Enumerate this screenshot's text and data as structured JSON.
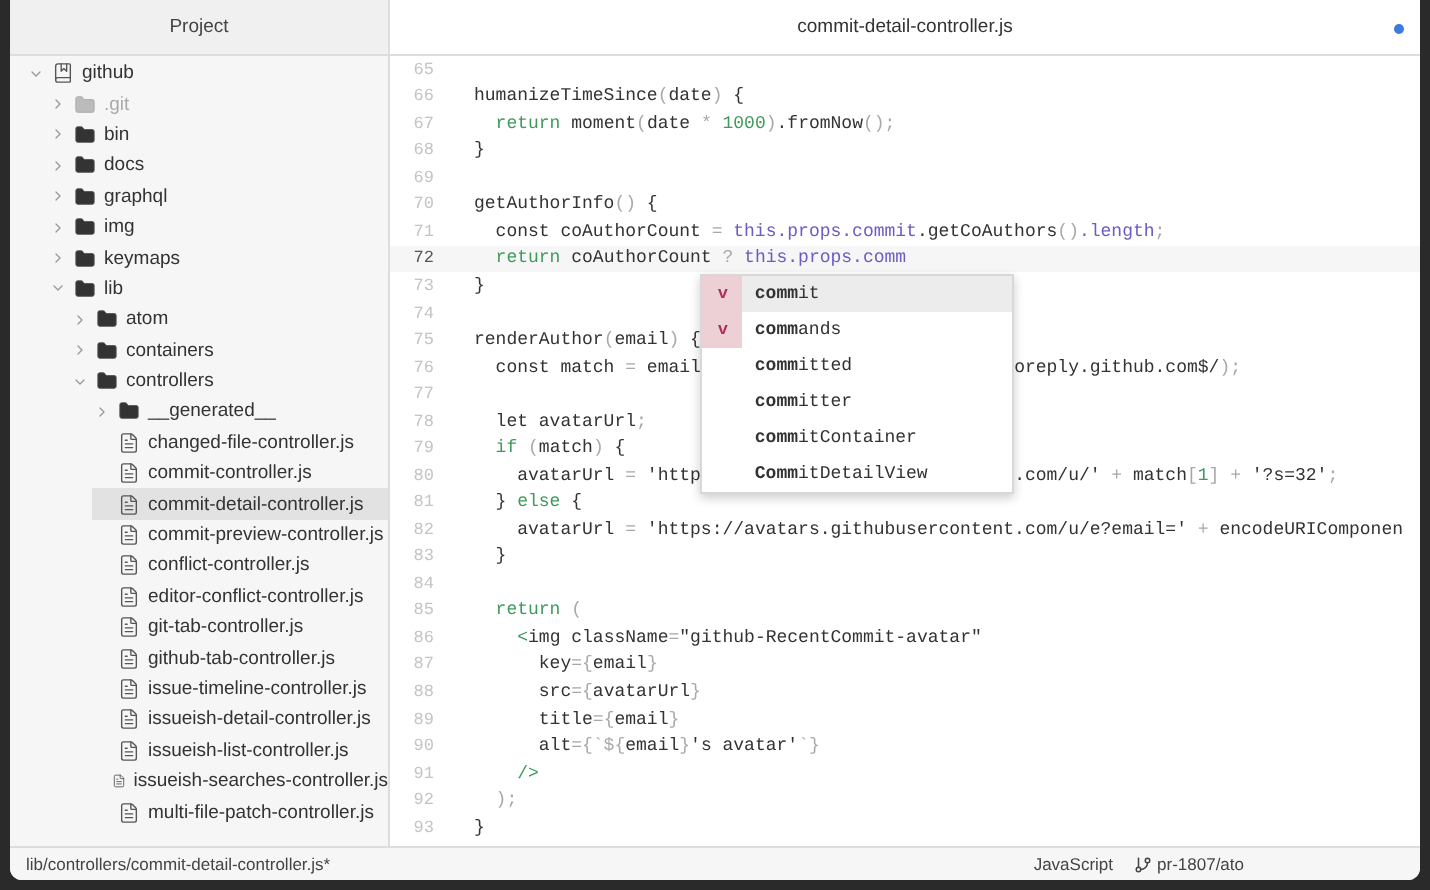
{
  "sidebar": {
    "title": "Project",
    "tree": [
      {
        "name": "github",
        "kind": "repo",
        "expanded": true,
        "selected": false,
        "dim": false,
        "children": [
          {
            "name": ".git",
            "kind": "folder",
            "expanded": false,
            "selected": false,
            "dim": true
          },
          {
            "name": "bin",
            "kind": "folder",
            "expanded": false,
            "selected": false,
            "dim": false
          },
          {
            "name": "docs",
            "kind": "folder",
            "expanded": false,
            "selected": false,
            "dim": false
          },
          {
            "name": "graphql",
            "kind": "folder",
            "expanded": false,
            "selected": false,
            "dim": false
          },
          {
            "name": "img",
            "kind": "folder",
            "expanded": false,
            "selected": false,
            "dim": false
          },
          {
            "name": "keymaps",
            "kind": "folder",
            "expanded": false,
            "selected": false,
            "dim": false
          },
          {
            "name": "lib",
            "kind": "folder",
            "expanded": true,
            "selected": false,
            "dim": false,
            "children": [
              {
                "name": "atom",
                "kind": "folder",
                "expanded": false,
                "selected": false,
                "dim": false
              },
              {
                "name": "containers",
                "kind": "folder",
                "expanded": false,
                "selected": false,
                "dim": false
              },
              {
                "name": "controllers",
                "kind": "folder",
                "expanded": true,
                "selected": false,
                "dim": false,
                "children": [
                  {
                    "name": "__generated__",
                    "kind": "folder",
                    "expanded": false,
                    "selected": false,
                    "dim": false
                  },
                  {
                    "name": "changed-file-controller.js",
                    "kind": "file",
                    "selected": false,
                    "dim": false
                  },
                  {
                    "name": "commit-controller.js",
                    "kind": "file",
                    "selected": false,
                    "dim": false
                  },
                  {
                    "name": "commit-detail-controller.js",
                    "kind": "file",
                    "selected": true,
                    "dim": false
                  },
                  {
                    "name": "commit-preview-controller.js",
                    "kind": "file",
                    "selected": false,
                    "dim": false
                  },
                  {
                    "name": "conflict-controller.js",
                    "kind": "file",
                    "selected": false,
                    "dim": false
                  },
                  {
                    "name": "editor-conflict-controller.js",
                    "kind": "file",
                    "selected": false,
                    "dim": false
                  },
                  {
                    "name": "git-tab-controller.js",
                    "kind": "file",
                    "selected": false,
                    "dim": false
                  },
                  {
                    "name": "github-tab-controller.js",
                    "kind": "file",
                    "selected": false,
                    "dim": false
                  },
                  {
                    "name": "issue-timeline-controller.js",
                    "kind": "file",
                    "selected": false,
                    "dim": false
                  },
                  {
                    "name": "issueish-detail-controller.js",
                    "kind": "file",
                    "selected": false,
                    "dim": false
                  },
                  {
                    "name": "issueish-list-controller.js",
                    "kind": "file",
                    "selected": false,
                    "dim": false
                  },
                  {
                    "name": "issueish-searches-controller.js",
                    "kind": "file",
                    "selected": false,
                    "dim": false
                  },
                  {
                    "name": "multi-file-patch-controller.js",
                    "kind": "file",
                    "selected": false,
                    "dim": false
                  }
                ]
              }
            ]
          }
        ]
      }
    ]
  },
  "editor": {
    "tab": {
      "title": "commit-detail-controller.js",
      "modified": true
    },
    "lines": [
      {
        "number": "65",
        "current": false
      },
      {
        "number": "66",
        "current": false,
        "tokens": [
          {
            "text": "humanizeTimeSince",
            "kind": "plain"
          },
          {
            "text": "(",
            "kind": "punct"
          },
          {
            "text": "date",
            "kind": "plain"
          },
          {
            "text": ")",
            "kind": "punct"
          },
          {
            "text": " {",
            "kind": "plain"
          }
        ]
      },
      {
        "number": "67",
        "current": false,
        "tokens": [
          {
            "text": "  return",
            "kind": "keyword"
          },
          {
            "text": " moment",
            "kind": "plain"
          },
          {
            "text": "(",
            "kind": "punct"
          },
          {
            "text": "date ",
            "kind": "plain"
          },
          {
            "text": "*",
            "kind": "punct"
          },
          {
            "text": " 1000",
            "kind": "keyword"
          },
          {
            "text": ")",
            "kind": "punct"
          },
          {
            "text": ".fromNow",
            "kind": "plain"
          },
          {
            "text": "();",
            "kind": "punct"
          }
        ]
      },
      {
        "number": "68",
        "current": false,
        "tokens": [
          {
            "text": "}",
            "kind": "plain"
          }
        ]
      },
      {
        "number": "69",
        "current": false
      },
      {
        "number": "70",
        "current": false,
        "tokens": [
          {
            "text": "getAuthorInfo",
            "kind": "plain"
          },
          {
            "text": "()",
            "kind": "punct"
          },
          {
            "text": " {",
            "kind": "plain"
          }
        ]
      },
      {
        "number": "71",
        "current": false,
        "tokens": [
          {
            "text": "  const coAuthorCount ",
            "kind": "plain"
          },
          {
            "text": "=",
            "kind": "punct"
          },
          {
            "text": " this.props.commit",
            "kind": "prop"
          },
          {
            "text": ".getCoAuthors",
            "kind": "plain"
          },
          {
            "text": "()",
            "kind": "punct"
          },
          {
            "text": ".length",
            "kind": "prop"
          },
          {
            "text": ";",
            "kind": "punct"
          }
        ]
      },
      {
        "number": "72",
        "current": true,
        "tokens": [
          {
            "text": "  return",
            "kind": "keyword"
          },
          {
            "text": " coAuthorCount ",
            "kind": "plain"
          },
          {
            "text": "?",
            "kind": "punct"
          },
          {
            "text": " this.props.comm",
            "kind": "prop"
          }
        ]
      },
      {
        "number": "73",
        "current": false,
        "tokens": [
          {
            "text": "}",
            "kind": "plain"
          }
        ]
      },
      {
        "number": "74",
        "current": false
      },
      {
        "number": "75",
        "current": false,
        "tokens": [
          {
            "text": "renderAuthor",
            "kind": "plain"
          },
          {
            "text": "(",
            "kind": "punct"
          },
          {
            "text": "email",
            "kind": "plain"
          },
          {
            "text": ")",
            "kind": "punct"
          },
          {
            "text": " {",
            "kind": "plain"
          }
        ]
      },
      {
        "number": "76",
        "current": false,
        "tokens": [
          {
            "text": "  const match ",
            "kind": "plain"
          },
          {
            "text": "=",
            "kind": "punct"
          },
          {
            "text": " email",
            "kind": "plain"
          }
        ],
        "tail": [
          {
            "text": "oreply.github.com$/",
            "kind": "plain"
          },
          {
            "text": ");",
            "kind": "punct"
          }
        ]
      },
      {
        "number": "77",
        "current": false
      },
      {
        "number": "78",
        "current": false,
        "tokens": [
          {
            "text": "  let avatarUrl",
            "kind": "plain"
          },
          {
            "text": ";",
            "kind": "punct"
          }
        ]
      },
      {
        "number": "79",
        "current": false,
        "tokens": [
          {
            "text": "  if",
            "kind": "keyword"
          },
          {
            "text": " (",
            "kind": "punct"
          },
          {
            "text": "match",
            "kind": "plain"
          },
          {
            "text": ")",
            "kind": "punct"
          },
          {
            "text": " {",
            "kind": "plain"
          }
        ]
      },
      {
        "number": "80",
        "current": false,
        "tokens": [
          {
            "text": "    avatarUrl ",
            "kind": "plain"
          },
          {
            "text": "=",
            "kind": "punct"
          },
          {
            "text": " 'http",
            "kind": "plain"
          }
        ],
        "tail": [
          {
            "text": ".com/u/' ",
            "kind": "plain"
          },
          {
            "text": "+",
            "kind": "punct"
          },
          {
            "text": " match",
            "kind": "plain"
          },
          {
            "text": "[",
            "kind": "punct"
          },
          {
            "text": "1",
            "kind": "keyword"
          },
          {
            "text": "]",
            "kind": "punct"
          },
          {
            "text": " + ",
            "kind": "punct"
          },
          {
            "text": "'?s=32'",
            "kind": "plain"
          },
          {
            "text": ";",
            "kind": "punct"
          }
        ]
      },
      {
        "number": "81",
        "current": false,
        "tokens": [
          {
            "text": "  } ",
            "kind": "plain"
          },
          {
            "text": "else",
            "kind": "keyword"
          },
          {
            "text": " {",
            "kind": "plain"
          }
        ]
      },
      {
        "number": "82",
        "current": false,
        "tokens": [
          {
            "text": "    avatarUrl ",
            "kind": "plain"
          },
          {
            "text": "=",
            "kind": "punct"
          },
          {
            "text": " 'https://avatars.githubusercontent.com/u/e?email=' ",
            "kind": "plain"
          },
          {
            "text": "+",
            "kind": "punct"
          },
          {
            "text": " encodeURIComponen",
            "kind": "plain"
          }
        ]
      },
      {
        "number": "83",
        "current": false,
        "tokens": [
          {
            "text": "  }",
            "kind": "plain"
          }
        ]
      },
      {
        "number": "84",
        "current": false
      },
      {
        "number": "85",
        "current": false,
        "tokens": [
          {
            "text": "  return",
            "kind": "keyword"
          },
          {
            "text": " (",
            "kind": "punct"
          }
        ]
      },
      {
        "number": "86",
        "current": false,
        "tokens": [
          {
            "text": "    <",
            "kind": "keyword"
          },
          {
            "text": "img className",
            "kind": "plain"
          },
          {
            "text": "=",
            "kind": "punct"
          },
          {
            "text": "\"github-RecentCommit-avatar\"",
            "kind": "plain"
          }
        ]
      },
      {
        "number": "87",
        "current": false,
        "tokens": [
          {
            "text": "      key",
            "kind": "plain"
          },
          {
            "text": "={",
            "kind": "punct"
          },
          {
            "text": "email",
            "kind": "plain"
          },
          {
            "text": "}",
            "kind": "punct"
          }
        ]
      },
      {
        "number": "88",
        "current": false,
        "tokens": [
          {
            "text": "      src",
            "kind": "plain"
          },
          {
            "text": "={",
            "kind": "punct"
          },
          {
            "text": "avatarUrl",
            "kind": "plain"
          },
          {
            "text": "}",
            "kind": "punct"
          }
        ]
      },
      {
        "number": "89",
        "current": false,
        "tokens": [
          {
            "text": "      title",
            "kind": "plain"
          },
          {
            "text": "={",
            "kind": "punct"
          },
          {
            "text": "email",
            "kind": "plain"
          },
          {
            "text": "}",
            "kind": "punct"
          }
        ]
      },
      {
        "number": "90",
        "current": false,
        "tokens": [
          {
            "text": "      alt",
            "kind": "plain"
          },
          {
            "text": "={`${",
            "kind": "punct"
          },
          {
            "text": "email",
            "kind": "plain"
          },
          {
            "text": "}",
            "kind": "punct"
          },
          {
            "text": "'s avatar'",
            "kind": "plain"
          },
          {
            "text": "`}",
            "kind": "punct"
          }
        ]
      },
      {
        "number": "91",
        "current": false,
        "tokens": [
          {
            "text": "    />",
            "kind": "keyword"
          }
        ]
      },
      {
        "number": "92",
        "current": false,
        "tokens": [
          {
            "text": "  );",
            "kind": "punct"
          }
        ]
      },
      {
        "number": "93",
        "current": false,
        "tokens": [
          {
            "text": "}",
            "kind": "plain"
          }
        ]
      }
    ],
    "autocomplete": [
      {
        "badge": "v",
        "label": "**comm**it",
        "selected": true
      },
      {
        "badge": "v",
        "label": "**comm**ands",
        "selected": false
      },
      {
        "label": "**comm**itted",
        "selected": false
      },
      {
        "label": "**comm**itter",
        "selected": false
      },
      {
        "label": "**comm**itContainer",
        "selected": false
      },
      {
        "label": "**Comm**itDetailView",
        "selected": false
      }
    ]
  },
  "status_bar": {
    "path": "lib/controllers/commit-detail-controller.js*",
    "grammar": "JavaScript",
    "branch": "pr-1807/ato"
  }
}
